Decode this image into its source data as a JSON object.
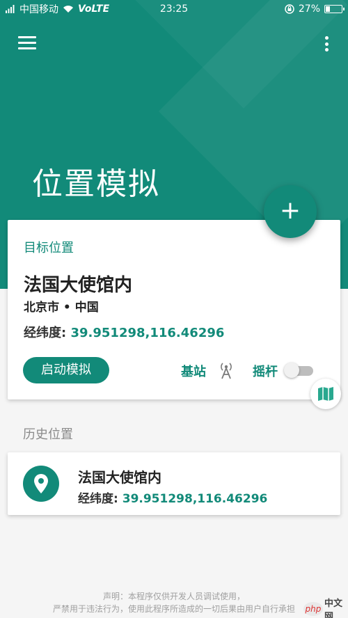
{
  "status_bar": {
    "carrier": "中国移动",
    "volte": "VoLTE",
    "time": "23:25",
    "battery_percent": "27%",
    "battery_level": 0.27
  },
  "header": {
    "title": "位置模拟"
  },
  "target": {
    "label": "目标位置",
    "name": "法国大使馆内",
    "region": "北京市 • 中国",
    "coord_label": "经纬度:",
    "coord_value": "39.951298,116.46296",
    "start_button": "启动模拟",
    "base_station_label": "基站",
    "joystick_label": "摇杆",
    "joystick_enabled": false
  },
  "history": {
    "title": "历史位置",
    "items": [
      {
        "name": "法国大使馆内",
        "coord_label": "经纬度:",
        "coord_value": "39.951298,116.46296"
      }
    ]
  },
  "footer": {
    "line1": "声明：本程序仅供开发人员调试使用，",
    "line2": "严禁用于违法行为，使用此程序所造成的一切后果由用户自行承担"
  },
  "watermark": {
    "brand": "php",
    "text": "中文网"
  },
  "colors": {
    "primary": "#128a79",
    "background": "#f5f5f5"
  },
  "icons": {
    "menu": "menu-icon",
    "more": "more-vert-icon",
    "fab": "plus-icon",
    "base_station": "antenna-icon",
    "side": "map-icon",
    "history_item": "location-pin-icon"
  }
}
